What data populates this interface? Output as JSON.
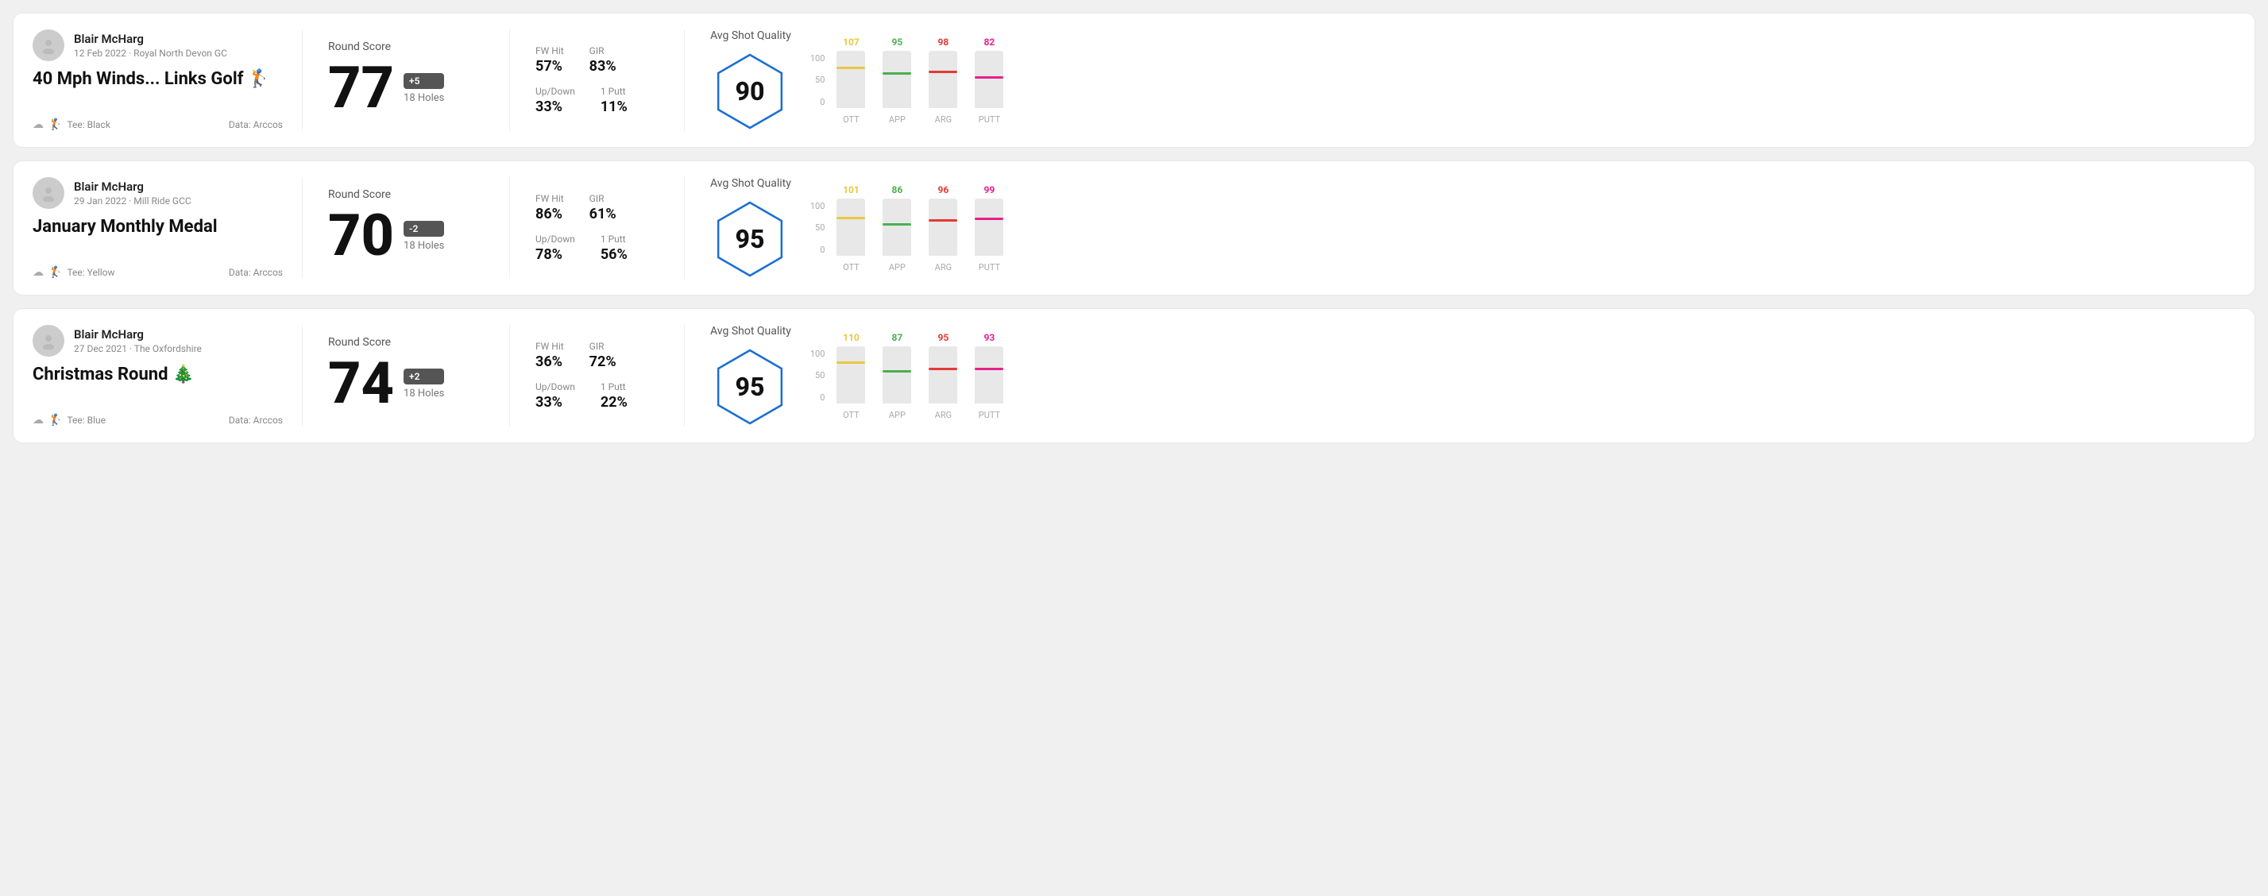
{
  "rounds": [
    {
      "id": "round1",
      "user": {
        "name": "Blair McHarg",
        "date": "12 Feb 2022",
        "course": "Royal North Devon GC"
      },
      "title": "40 Mph Winds... Links Golf 🏌️",
      "tee": "Black",
      "data_source": "Data: Arccos",
      "round_score_label": "Round Score",
      "score": "77",
      "score_diff": "+5",
      "holes": "18 Holes",
      "fw_hit_label": "FW Hit",
      "fw_hit": "57%",
      "gir_label": "GIR",
      "gir": "83%",
      "updown_label": "Up/Down",
      "updown": "33%",
      "putt_label": "1 Putt",
      "putt": "11%",
      "avg_shot_label": "Avg Shot Quality",
      "quality_score": "90",
      "chart": {
        "bars": [
          {
            "label": "OTT",
            "value": 107,
            "color": "#e8c840",
            "pct": 72
          },
          {
            "label": "APP",
            "value": 95,
            "color": "#4caf50",
            "pct": 63
          },
          {
            "label": "ARG",
            "value": 98,
            "color": "#e53935",
            "pct": 65
          },
          {
            "label": "PUTT",
            "value": 82,
            "color": "#e91e8c",
            "pct": 55
          }
        ]
      }
    },
    {
      "id": "round2",
      "user": {
        "name": "Blair McHarg",
        "date": "29 Jan 2022",
        "course": "Mill Ride GCC"
      },
      "title": "January Monthly Medal",
      "tee": "Yellow",
      "data_source": "Data: Arccos",
      "round_score_label": "Round Score",
      "score": "70",
      "score_diff": "-2",
      "holes": "18 Holes",
      "fw_hit_label": "FW Hit",
      "fw_hit": "86%",
      "gir_label": "GIR",
      "gir": "61%",
      "updown_label": "Up/Down",
      "updown": "78%",
      "putt_label": "1 Putt",
      "putt": "56%",
      "avg_shot_label": "Avg Shot Quality",
      "quality_score": "95",
      "chart": {
        "bars": [
          {
            "label": "OTT",
            "value": 101,
            "color": "#e8c840",
            "pct": 68
          },
          {
            "label": "APP",
            "value": 86,
            "color": "#4caf50",
            "pct": 57
          },
          {
            "label": "ARG",
            "value": 96,
            "color": "#e53935",
            "pct": 64
          },
          {
            "label": "PUTT",
            "value": 99,
            "color": "#e91e8c",
            "pct": 66
          }
        ]
      }
    },
    {
      "id": "round3",
      "user": {
        "name": "Blair McHarg",
        "date": "27 Dec 2021",
        "course": "The Oxfordshire"
      },
      "title": "Christmas Round 🎄",
      "tee": "Blue",
      "data_source": "Data: Arccos",
      "round_score_label": "Round Score",
      "score": "74",
      "score_diff": "+2",
      "holes": "18 Holes",
      "fw_hit_label": "FW Hit",
      "fw_hit": "36%",
      "gir_label": "GIR",
      "gir": "72%",
      "updown_label": "Up/Down",
      "updown": "33%",
      "putt_label": "1 Putt",
      "putt": "22%",
      "avg_shot_label": "Avg Shot Quality",
      "quality_score": "95",
      "chart": {
        "bars": [
          {
            "label": "OTT",
            "value": 110,
            "color": "#e8c840",
            "pct": 73
          },
          {
            "label": "APP",
            "value": 87,
            "color": "#4caf50",
            "pct": 58
          },
          {
            "label": "ARG",
            "value": 95,
            "color": "#e53935",
            "pct": 63
          },
          {
            "label": "PUTT",
            "value": 93,
            "color": "#e91e8c",
            "pct": 62
          }
        ]
      }
    }
  ]
}
